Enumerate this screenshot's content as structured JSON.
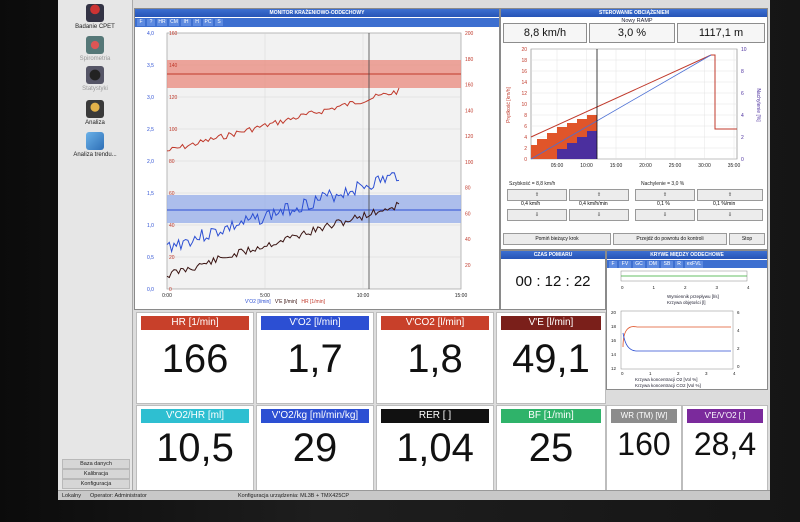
{
  "sidebar": {
    "items": [
      {
        "label": "Badanie CPET"
      },
      {
        "label": "Spirometria"
      },
      {
        "label": "Statystyki"
      },
      {
        "label": "Analiza"
      },
      {
        "label": "Analiza trendu..."
      }
    ],
    "bottom": [
      "Baza danych",
      "Kalibracja",
      "Konfiguracja"
    ]
  },
  "status": {
    "mode": "Lokalny",
    "operator": "Operator: Administrator",
    "config": "Konfiguracja urządzenia:  ML3B + TMX425CP"
  },
  "monitor": {
    "title": "MONITOR KRAŻENIOWO-ODDECHOWY",
    "toolbar": [
      "F",
      "?",
      "HR",
      "CM",
      "IH",
      "H",
      "PC",
      "S"
    ],
    "left_ticks": [
      "4,0",
      "3,5",
      "3,0",
      "2,5",
      "2,0",
      "1,5",
      "1,0",
      "0,5",
      "0,0"
    ],
    "hr_left_ticks": [
      "160",
      "140",
      "120",
      "100",
      "80",
      "60",
      "40",
      "20",
      "0"
    ],
    "right_ticks": [
      "200",
      "180",
      "160",
      "140",
      "120",
      "100",
      "80",
      "60",
      "40",
      "20"
    ],
    "x_ticks": [
      "0:00",
      "5:00",
      "10:00",
      "15:00"
    ],
    "legend": [
      "V'O2 [l/min]",
      "V'E [l/min]",
      "HR [1/min]"
    ]
  },
  "load": {
    "title": "STEROWANIE OBCIĄŻENIEM",
    "protocol": "Nowy RAMP",
    "speed": "8,8 km/h",
    "incline": "3,0 %",
    "distance": "1117,1 m",
    "y_left_label": "Prędkość [km/h]",
    "y_right_label": "Nachylenie [%]",
    "y_ticks": [
      "20",
      "18",
      "16",
      "14",
      "12",
      "10",
      "8",
      "6",
      "4",
      "2",
      "0"
    ],
    "y_right_ticks": [
      "10",
      "8",
      "6",
      "4",
      "2",
      "0"
    ],
    "x_ticks": [
      "05:00",
      "10:00",
      "15:00",
      "20:00",
      "25:00",
      "30:00",
      "35:00"
    ],
    "speed_label": "Szybkość = 8,8 km/h",
    "incline_label": "Nachylenie = 3,0 %",
    "step_labels": [
      "0,4 km/h",
      "0,4 km/h/min",
      "0,1 %",
      "0,1 %/min"
    ],
    "btn_skip": "Pomiń bieżący krok",
    "btn_back": "Przejdź do powrotu do kontroli",
    "btn_stop": "Stop"
  },
  "timer": {
    "title": "CZAS POMIARU",
    "value": "00 : 12 : 22"
  },
  "breath": {
    "title": "KRYWE MIĘDZY ODDECHOWE",
    "toolbar": [
      "F",
      "FV",
      "GC",
      "DM",
      "SB",
      "R",
      "exFVL"
    ],
    "legend1": [
      "Wymiennik przepływu [l/s]",
      "Krzywa objętości [l]"
    ],
    "legend2": [
      "Krzywa koncentracji O2 [Vol %]",
      "Krzywa koncentracji CO2 [Vol %]"
    ],
    "top_ticks": [
      "0",
      "1",
      "2",
      "3",
      "4"
    ],
    "y_ticks": [
      "20",
      "18",
      "16",
      "14",
      "12"
    ],
    "y_right": [
      "6",
      "4",
      "2",
      "0"
    ],
    "x_ticks": [
      "0",
      "1",
      "2",
      "3",
      "4"
    ]
  },
  "cards": [
    {
      "label": "HR [1/min]",
      "value": "166",
      "color": "#c8402a"
    },
    {
      "label": "V'O2 [l/min]",
      "value": "1,7",
      "color": "#2c4fd3"
    },
    {
      "label": "V'CO2 [l/min]",
      "value": "1,8",
      "color": "#c8402a"
    },
    {
      "label": "V'E [l/min]",
      "value": "49,1",
      "color": "#7a1f1a"
    },
    {
      "label": "V'O2/HR [ml]",
      "value": "10,5",
      "color": "#2ebfd1"
    },
    {
      "label": "V'O2/kg [ml/min/kg]",
      "value": "29",
      "color": "#2c4fd3"
    },
    {
      "label": "RER [ ]",
      "value": "1,04",
      "color": "#111111"
    },
    {
      "label": "BF [1/min]",
      "value": "25",
      "color": "#2fb36a"
    },
    {
      "label": "WR (TM) [W]",
      "value": "160",
      "color": "#8c8c8c"
    },
    {
      "label": "V'E/V'O2 [ ]",
      "value": "28,4",
      "color": "#7b2a9c"
    }
  ]
}
